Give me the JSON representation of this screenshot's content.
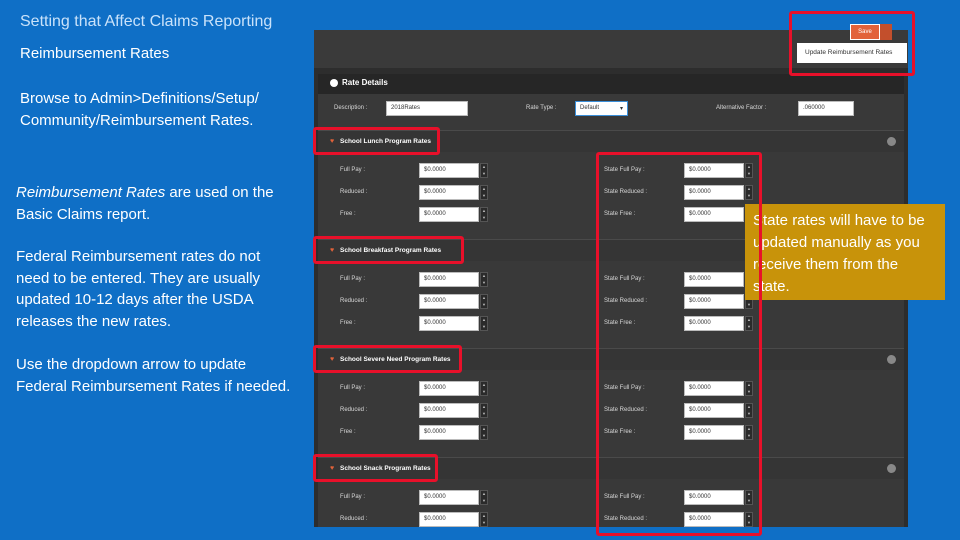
{
  "slide": {
    "title": "Setting that Affect Claims Reporting",
    "subtitle": "Reimbursement Rates",
    "browse": "Browse to Admin>Definitions/Setup/ Community/Reimbursement Rates.",
    "used_em": "Reimbursement Rates",
    "used_rest": " are used on the Basic Claims report.",
    "federal": "Federal Reimbursement rates do not need to be entered.  They are usually updated 10-12 days after the USDA releases the new rates.",
    "dropdown": "Use the dropdown arrow to update Federal Reimbursement Rates if needed.",
    "callout": "State rates will have to be updated manually as you receive them from the state."
  },
  "toolbar": {
    "save_label": "Save",
    "update_label": "Update Reimbursement Rates"
  },
  "rate_details": {
    "heading": "Rate Details",
    "description_label": "Description :",
    "description_value": "2018Rates",
    "rate_type_label": "Rate Type :",
    "rate_type_value": "Default",
    "alt_factor_label": "Alternative Factor :",
    "alt_factor_value": ".060000"
  },
  "sections": [
    {
      "title": "School Lunch Program Rates",
      "rows": [
        {
          "label": "Full Pay :",
          "value": "$0.0000",
          "state_label": "State Full Pay :",
          "state_value": "$0.0000"
        },
        {
          "label": "Reduced :",
          "value": "$0.0000",
          "state_label": "State Reduced :",
          "state_value": "$0.0000"
        },
        {
          "label": "Free :",
          "value": "$0.0000",
          "state_label": "State Free :",
          "state_value": "$0.0000"
        }
      ]
    },
    {
      "title": "School Breakfast Program Rates",
      "rows": [
        {
          "label": "Full Pay :",
          "value": "$0.0000",
          "state_label": "State Full Pay :",
          "state_value": "$0.0000"
        },
        {
          "label": "Reduced :",
          "value": "$0.0000",
          "state_label": "State Reduced :",
          "state_value": "$0.0000"
        },
        {
          "label": "Free :",
          "value": "$0.0000",
          "state_label": "State Free :",
          "state_value": "$0.0000"
        }
      ]
    },
    {
      "title": "School Severe Need Program Rates",
      "rows": [
        {
          "label": "Full Pay :",
          "value": "$0.0000",
          "state_label": "State Full Pay :",
          "state_value": "$0.0000"
        },
        {
          "label": "Reduced :",
          "value": "$0.0000",
          "state_label": "State Reduced :",
          "state_value": "$0.0000"
        },
        {
          "label": "Free :",
          "value": "$0.0000",
          "state_label": "State Free :",
          "state_value": "$0.0000"
        }
      ]
    },
    {
      "title": "School Snack Program Rates",
      "rows": [
        {
          "label": "Full Pay :",
          "value": "$0.0000",
          "state_label": "State Full Pay :",
          "state_value": "$0.0000"
        },
        {
          "label": "Reduced :",
          "value": "$0.0000",
          "state_label": "State Reduced :",
          "state_value": "$0.0000"
        }
      ]
    }
  ],
  "colors": {
    "slide_background": "#0f6fc6",
    "highlight": "#e8102a",
    "callout": "#c8930a",
    "accent": "#e2623a"
  }
}
